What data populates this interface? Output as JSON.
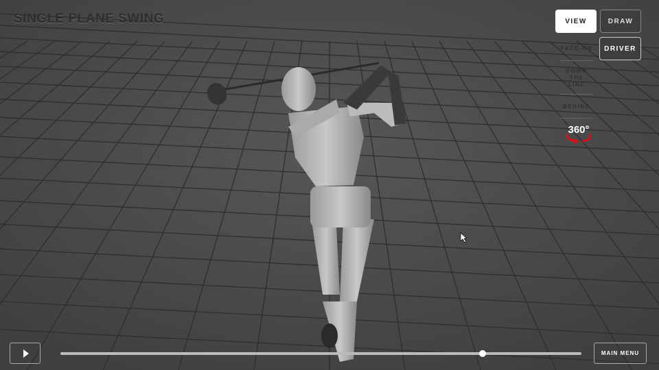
{
  "title": "SINGLE PLANE SWING",
  "mode_buttons": {
    "view": "VIEW",
    "draw": "DRAW"
  },
  "club_button": "DRIVER",
  "view_options": [
    "FACE-ON",
    "DOWN THE LINE",
    "BEHIND"
  ],
  "rotate_label": "360°",
  "playback": {
    "progress": 0.81
  },
  "main_menu": "MAIN MENU"
}
